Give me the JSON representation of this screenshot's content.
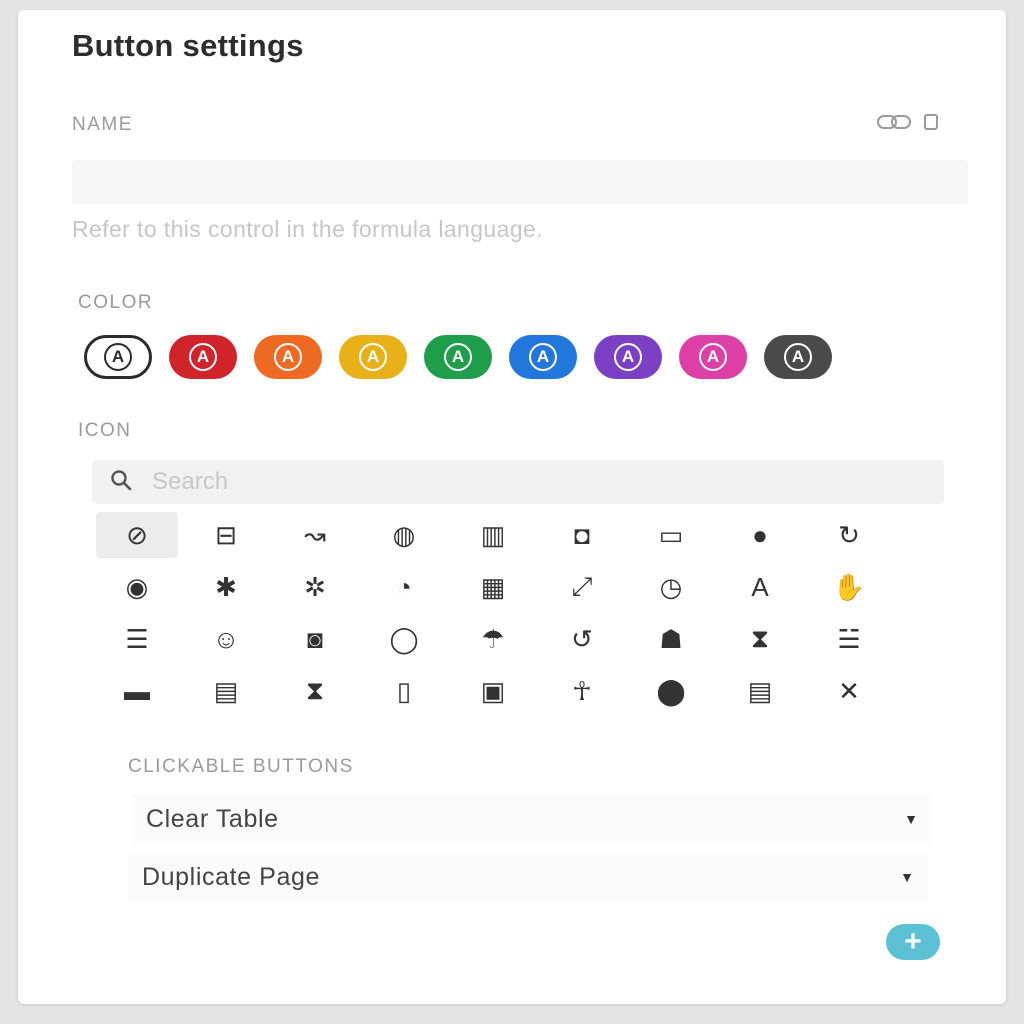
{
  "panel": {
    "title": "Button settings"
  },
  "name_section": {
    "label": "NAME",
    "input_value": "",
    "hint": "Refer to this control in the formula language.",
    "actions": [
      "link-icon",
      "copy-icon"
    ]
  },
  "color_section": {
    "label": "COLOR",
    "swatch_letter": "A",
    "swatches": [
      {
        "color": "#ffffff",
        "selected": true
      },
      {
        "color": "#d1232a",
        "selected": false
      },
      {
        "color": "#ee6a22",
        "selected": false
      },
      {
        "color": "#e8b019",
        "selected": false
      },
      {
        "color": "#1e9d4a",
        "selected": false
      },
      {
        "color": "#2277dd",
        "selected": false
      },
      {
        "color": "#7b3fc4",
        "selected": false
      },
      {
        "color": "#dc3fa6",
        "selected": false
      },
      {
        "color": "#4a4a4a",
        "selected": false
      }
    ]
  },
  "icon_section": {
    "label": "ICON",
    "search_placeholder": "Search",
    "icons": [
      {
        "name": "slash-circle-icon",
        "glyph": "⊘",
        "selected": true
      },
      {
        "name": "tray-icon",
        "glyph": "⊟"
      },
      {
        "name": "arrow-curve-icon",
        "glyph": "↝"
      },
      {
        "name": "globe-icon",
        "glyph": "◍"
      },
      {
        "name": "book-icon",
        "glyph": "▥"
      },
      {
        "name": "camera-icon",
        "glyph": "◘"
      },
      {
        "name": "card-icon",
        "glyph": "▭"
      },
      {
        "name": "alarm-icon",
        "glyph": "●"
      },
      {
        "name": "refresh-icon",
        "glyph": "↻"
      },
      {
        "name": "badge-icon",
        "glyph": "◉"
      },
      {
        "name": "bug-icon",
        "glyph": "✱"
      },
      {
        "name": "bug-alt-icon",
        "glyph": "✲"
      },
      {
        "name": "timer-icon",
        "glyph": "◔"
      },
      {
        "name": "calendar-icon",
        "glyph": "▦"
      },
      {
        "name": "expand-icon",
        "glyph": "⤢"
      },
      {
        "name": "clock-icon",
        "glyph": "◷"
      },
      {
        "name": "text-icon",
        "glyph": "A"
      },
      {
        "name": "hand-icon",
        "glyph": "✋"
      },
      {
        "name": "list-card-icon",
        "glyph": "☰"
      },
      {
        "name": "emoji-icon",
        "glyph": "☺"
      },
      {
        "name": "bus-icon",
        "glyph": "◙"
      },
      {
        "name": "circle-outline-icon",
        "glyph": "◯"
      },
      {
        "name": "umbrella-icon",
        "glyph": "☂"
      },
      {
        "name": "history-icon",
        "glyph": "↺"
      },
      {
        "name": "person-icon",
        "glyph": "☗"
      },
      {
        "name": "hourglass-icon",
        "glyph": "⧗"
      },
      {
        "name": "filter-icon",
        "glyph": "☱"
      },
      {
        "name": "cart-icon",
        "glyph": "▬"
      },
      {
        "name": "briefcase-icon",
        "glyph": "▤"
      },
      {
        "name": "hourglass-solid-icon",
        "glyph": "⧗"
      },
      {
        "name": "building-icon",
        "glyph": "▯"
      },
      {
        "name": "calendar-day-icon",
        "glyph": "▣"
      },
      {
        "name": "walk-icon",
        "glyph": "☥"
      },
      {
        "name": "alert-circle-icon",
        "glyph": "⬤"
      },
      {
        "name": "document-icon",
        "glyph": "▤"
      },
      {
        "name": "tools-icon",
        "glyph": "✕"
      }
    ]
  },
  "clickable_buttons": {
    "label": "CLICKABLE BUTTONS",
    "items": [
      {
        "label": "Clear Table"
      },
      {
        "label": "Duplicate Page"
      }
    ],
    "add_label": "+"
  }
}
